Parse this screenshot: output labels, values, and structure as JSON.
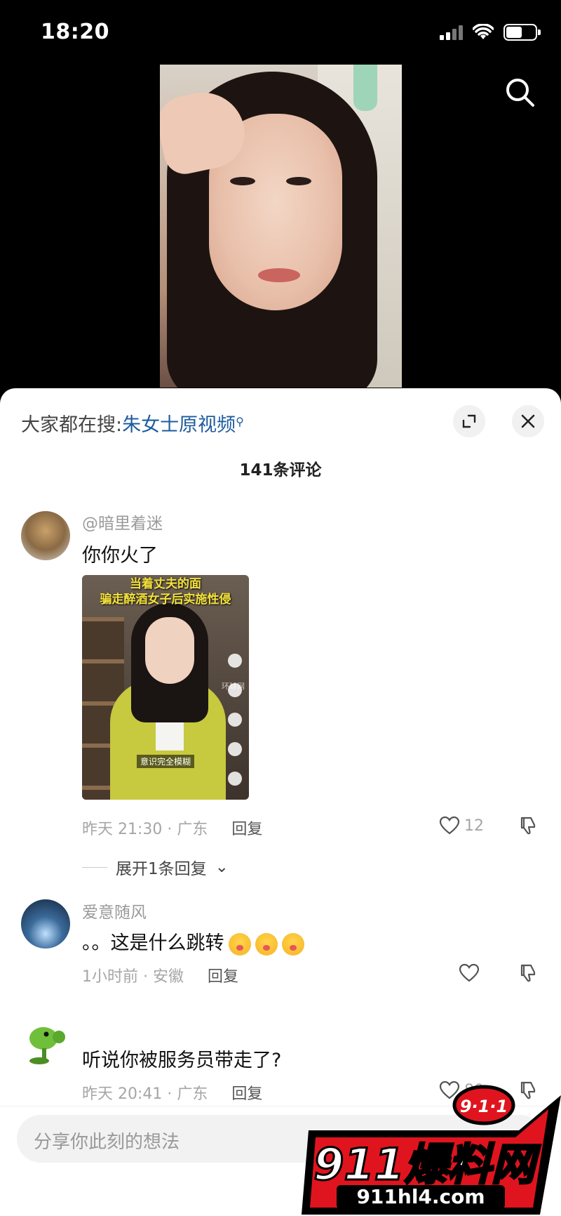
{
  "status_bar": {
    "time": "18:20",
    "battery_level": 0.55
  },
  "video": {
    "search_icon": "search-icon"
  },
  "comments_panel": {
    "suggest_prefix": "大家都在搜:",
    "suggest_term": "朱女士原视频",
    "comment_count": "141条评论",
    "expand_icon": "expand-icon",
    "close_icon": "close-icon"
  },
  "comments": [
    {
      "username": "@暗里着迷",
      "text": "你你火了",
      "image": {
        "title_line1": "当着丈夫的面",
        "title_line2": "骗走醉酒女子后实施性侵",
        "caption": "意识完全模糊",
        "watermark": "环球网"
      },
      "time_location": "昨天 21:30 · 广东",
      "reply_label": "回复",
      "likes": "12",
      "expand_replies": "展开1条回复"
    },
    {
      "username": "爱意随风",
      "text": "。。这是什么跳转",
      "emoji_count": 3,
      "time_location": "1小时前 · 安徽",
      "reply_label": "回复",
      "likes": ""
    },
    {
      "username": "",
      "text": "听说你被服务员带走了?",
      "time_location": "昨天 20:41 · 广东",
      "reply_label": "回复",
      "likes": "80"
    }
  ],
  "input": {
    "placeholder": "分享你此刻的想法"
  },
  "watermark": {
    "badge": "9·1·1",
    "brand": "911爆料网",
    "url": "911hl4.com"
  },
  "colors": {
    "link_blue": "#1d5c9f",
    "watermark_red": "#e0141e"
  }
}
